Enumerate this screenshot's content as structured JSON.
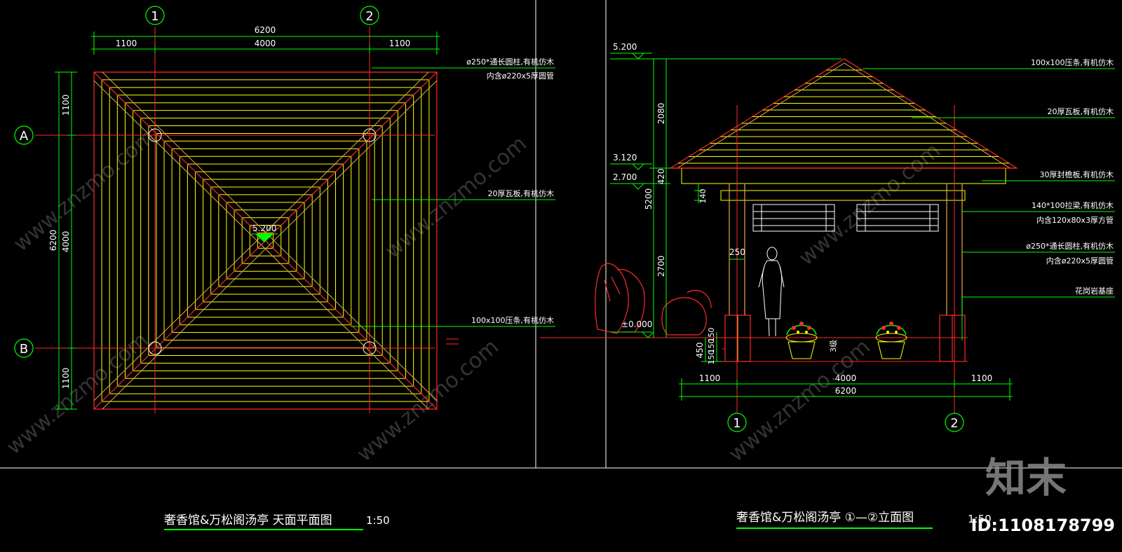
{
  "axes": {
    "grid1": "1",
    "grid2": "2",
    "gridA": "A",
    "gridB": "B"
  },
  "plan": {
    "dim_total": "6200",
    "dim_left": "1100",
    "dim_mid": "4000",
    "dim_right": "1100",
    "vdim_total": "6200",
    "vdim_top": "1100",
    "vdim_mid": "4000",
    "vdim_bottom": "1100",
    "apex_level": "5.200",
    "note_column_1": "ø250*通长圆柱,有机仿木",
    "note_column_2": "内含ø220x5厚圆管",
    "note_tile": "20厚瓦板,有机仿木",
    "note_ridge": "100x100压条,有机仿木",
    "title": "奢香馆&万松阁汤亭  天面平面图",
    "scale": "1:50"
  },
  "elevation": {
    "level_top": "5.200",
    "level_eave": "3.120",
    "level_beam": "2.700",
    "level_ground": "±0.000",
    "vdim_roof": "2080",
    "vdim_fascia": "420",
    "vdim_total": "5200",
    "vdim_beam": "140",
    "vdim_column": "2700",
    "vdim_base": "450",
    "vdim_step1": "150",
    "vdim_step2": "150",
    "vdim_step3": "150",
    "col_width": "250",
    "step_label": "3级",
    "dim_left": "1100",
    "dim_mid": "4000",
    "dim_right": "1100",
    "dim_total": "6200",
    "note_ridge": "100x100压条,有机仿木",
    "note_tile": "20厚瓦板,有机仿木",
    "note_fascia": "30厚封檐板,有机仿木",
    "note_beam_1": "140*100拉梁,有机仿木",
    "note_beam_2": "内含120x80x3厚方管",
    "note_column_1": "ø250*通长圆柱,有机仿木",
    "note_column_2": "内含ø220x5厚圆管",
    "note_base": "花岗岩基座",
    "title": "奢香馆&万松阁汤亭  ①—②立面图",
    "scale": "1:50"
  },
  "watermark": {
    "logo": "知末",
    "id": "ID:1108178799",
    "site": "www.znzmo.com"
  },
  "colors": {
    "yellow": "#FFFF00",
    "red": "#FF2A2A",
    "green": "#00FF00",
    "white": "#FFFFFF",
    "orange": "#E8A840"
  }
}
